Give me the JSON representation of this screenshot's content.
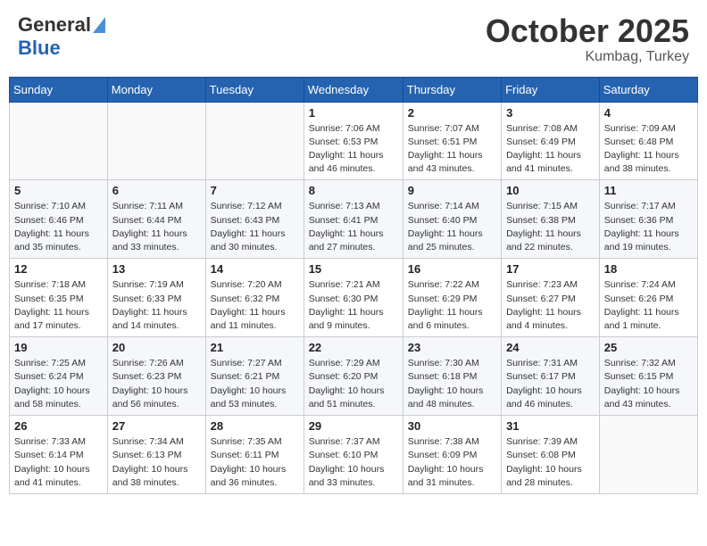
{
  "header": {
    "logo_general": "General",
    "logo_blue": "Blue",
    "month": "October 2025",
    "location": "Kumbag, Turkey"
  },
  "weekdays": [
    "Sunday",
    "Monday",
    "Tuesday",
    "Wednesday",
    "Thursday",
    "Friday",
    "Saturday"
  ],
  "weeks": [
    [
      {
        "day": "",
        "info": ""
      },
      {
        "day": "",
        "info": ""
      },
      {
        "day": "",
        "info": ""
      },
      {
        "day": "1",
        "info": "Sunrise: 7:06 AM\nSunset: 6:53 PM\nDaylight: 11 hours\nand 46 minutes."
      },
      {
        "day": "2",
        "info": "Sunrise: 7:07 AM\nSunset: 6:51 PM\nDaylight: 11 hours\nand 43 minutes."
      },
      {
        "day": "3",
        "info": "Sunrise: 7:08 AM\nSunset: 6:49 PM\nDaylight: 11 hours\nand 41 minutes."
      },
      {
        "day": "4",
        "info": "Sunrise: 7:09 AM\nSunset: 6:48 PM\nDaylight: 11 hours\nand 38 minutes."
      }
    ],
    [
      {
        "day": "5",
        "info": "Sunrise: 7:10 AM\nSunset: 6:46 PM\nDaylight: 11 hours\nand 35 minutes."
      },
      {
        "day": "6",
        "info": "Sunrise: 7:11 AM\nSunset: 6:44 PM\nDaylight: 11 hours\nand 33 minutes."
      },
      {
        "day": "7",
        "info": "Sunrise: 7:12 AM\nSunset: 6:43 PM\nDaylight: 11 hours\nand 30 minutes."
      },
      {
        "day": "8",
        "info": "Sunrise: 7:13 AM\nSunset: 6:41 PM\nDaylight: 11 hours\nand 27 minutes."
      },
      {
        "day": "9",
        "info": "Sunrise: 7:14 AM\nSunset: 6:40 PM\nDaylight: 11 hours\nand 25 minutes."
      },
      {
        "day": "10",
        "info": "Sunrise: 7:15 AM\nSunset: 6:38 PM\nDaylight: 11 hours\nand 22 minutes."
      },
      {
        "day": "11",
        "info": "Sunrise: 7:17 AM\nSunset: 6:36 PM\nDaylight: 11 hours\nand 19 minutes."
      }
    ],
    [
      {
        "day": "12",
        "info": "Sunrise: 7:18 AM\nSunset: 6:35 PM\nDaylight: 11 hours\nand 17 minutes."
      },
      {
        "day": "13",
        "info": "Sunrise: 7:19 AM\nSunset: 6:33 PM\nDaylight: 11 hours\nand 14 minutes."
      },
      {
        "day": "14",
        "info": "Sunrise: 7:20 AM\nSunset: 6:32 PM\nDaylight: 11 hours\nand 11 minutes."
      },
      {
        "day": "15",
        "info": "Sunrise: 7:21 AM\nSunset: 6:30 PM\nDaylight: 11 hours\nand 9 minutes."
      },
      {
        "day": "16",
        "info": "Sunrise: 7:22 AM\nSunset: 6:29 PM\nDaylight: 11 hours\nand 6 minutes."
      },
      {
        "day": "17",
        "info": "Sunrise: 7:23 AM\nSunset: 6:27 PM\nDaylight: 11 hours\nand 4 minutes."
      },
      {
        "day": "18",
        "info": "Sunrise: 7:24 AM\nSunset: 6:26 PM\nDaylight: 11 hours\nand 1 minute."
      }
    ],
    [
      {
        "day": "19",
        "info": "Sunrise: 7:25 AM\nSunset: 6:24 PM\nDaylight: 10 hours\nand 58 minutes."
      },
      {
        "day": "20",
        "info": "Sunrise: 7:26 AM\nSunset: 6:23 PM\nDaylight: 10 hours\nand 56 minutes."
      },
      {
        "day": "21",
        "info": "Sunrise: 7:27 AM\nSunset: 6:21 PM\nDaylight: 10 hours\nand 53 minutes."
      },
      {
        "day": "22",
        "info": "Sunrise: 7:29 AM\nSunset: 6:20 PM\nDaylight: 10 hours\nand 51 minutes."
      },
      {
        "day": "23",
        "info": "Sunrise: 7:30 AM\nSunset: 6:18 PM\nDaylight: 10 hours\nand 48 minutes."
      },
      {
        "day": "24",
        "info": "Sunrise: 7:31 AM\nSunset: 6:17 PM\nDaylight: 10 hours\nand 46 minutes."
      },
      {
        "day": "25",
        "info": "Sunrise: 7:32 AM\nSunset: 6:15 PM\nDaylight: 10 hours\nand 43 minutes."
      }
    ],
    [
      {
        "day": "26",
        "info": "Sunrise: 7:33 AM\nSunset: 6:14 PM\nDaylight: 10 hours\nand 41 minutes."
      },
      {
        "day": "27",
        "info": "Sunrise: 7:34 AM\nSunset: 6:13 PM\nDaylight: 10 hours\nand 38 minutes."
      },
      {
        "day": "28",
        "info": "Sunrise: 7:35 AM\nSunset: 6:11 PM\nDaylight: 10 hours\nand 36 minutes."
      },
      {
        "day": "29",
        "info": "Sunrise: 7:37 AM\nSunset: 6:10 PM\nDaylight: 10 hours\nand 33 minutes."
      },
      {
        "day": "30",
        "info": "Sunrise: 7:38 AM\nSunset: 6:09 PM\nDaylight: 10 hours\nand 31 minutes."
      },
      {
        "day": "31",
        "info": "Sunrise: 7:39 AM\nSunset: 6:08 PM\nDaylight: 10 hours\nand 28 minutes."
      },
      {
        "day": "",
        "info": ""
      }
    ]
  ]
}
